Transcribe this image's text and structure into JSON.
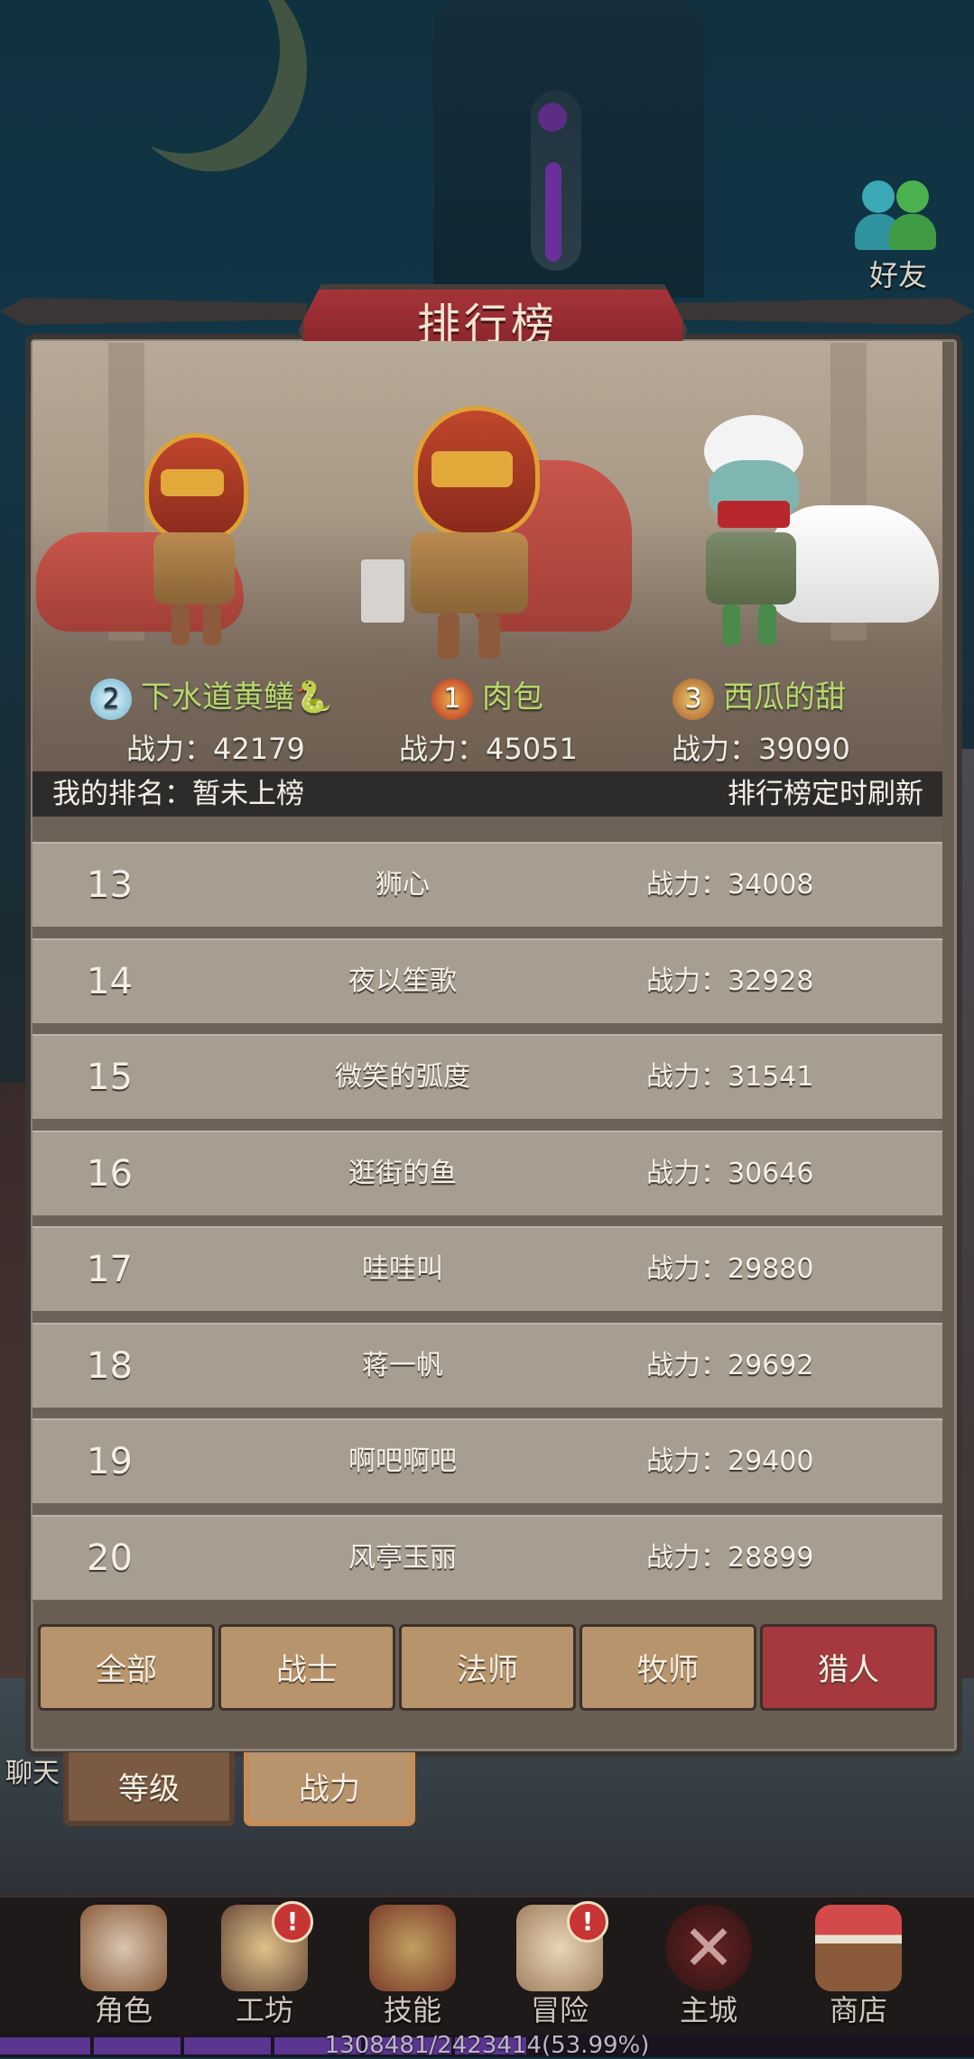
{
  "header": {
    "title": "排行榜",
    "friend_label": "好友"
  },
  "top3": [
    {
      "rank": "2",
      "name": "下水道黄鳝",
      "power": "战力：42179"
    },
    {
      "rank": "1",
      "name": "肉包",
      "power": "战力：45051"
    },
    {
      "rank": "3",
      "name": "西瓜的甜",
      "power": "战力：39090"
    }
  ],
  "my_rank": {
    "label": "我的排名：暂未上榜",
    "refresh_note": "排行榜定时刷新"
  },
  "rows": [
    {
      "rank": "13",
      "name": "狮心",
      "power": "战力：34008"
    },
    {
      "rank": "14",
      "name": "夜以笙歌",
      "power": "战力：32928"
    },
    {
      "rank": "15",
      "name": "微笑的弧度",
      "power": "战力：31541"
    },
    {
      "rank": "16",
      "name": "逛街的鱼",
      "power": "战力：30646"
    },
    {
      "rank": "17",
      "name": "哇哇叫",
      "power": "战力：29880"
    },
    {
      "rank": "18",
      "name": "蒋一帆",
      "power": "战力：29692"
    },
    {
      "rank": "19",
      "name": "啊吧啊吧",
      "power": "战力：29400"
    },
    {
      "rank": "20",
      "name": "风亭玉丽",
      "power": "战力：28899"
    }
  ],
  "class_tabs": [
    "全部",
    "战士",
    "法师",
    "牧师",
    "猎人"
  ],
  "active_class_tab": "猎人",
  "sort_tabs": {
    "level": "等级",
    "power": "战力"
  },
  "chat_label": "聊天",
  "bottom_nav": [
    {
      "label": "角色",
      "icon": "character-icon",
      "alert": ""
    },
    {
      "label": "工坊",
      "icon": "workshop-icon",
      "alert": "!"
    },
    {
      "label": "技能",
      "icon": "skill-book-icon",
      "alert": ""
    },
    {
      "label": "冒险",
      "icon": "adventure-icon",
      "alert": "!"
    },
    {
      "label": "主城",
      "icon": "main-city-icon",
      "alert": ""
    },
    {
      "label": "商店",
      "icon": "shop-icon",
      "alert": ""
    }
  ],
  "exp": {
    "text": "1308481/2423414(53.99%)",
    "fraction": 0.5399
  },
  "colors": {
    "active_tab": "#a5393f",
    "tab": "#b8946c",
    "name_green": "#b7d96a",
    "exp_fill": "#5b3690"
  }
}
